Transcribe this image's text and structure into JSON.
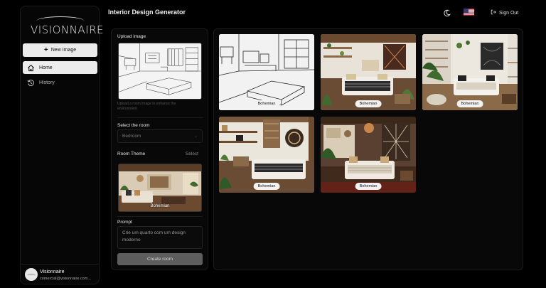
{
  "brand": {
    "logo_text": "VISIONNAIRE"
  },
  "sidebar": {
    "new_image_label": "New Image",
    "nav": [
      {
        "label": "Home",
        "icon": "home-icon",
        "active": true
      },
      {
        "label": "History",
        "icon": "history-icon",
        "active": false
      }
    ],
    "user": {
      "name": "Visionnaire",
      "email": "comercial@visionnaire.com..."
    }
  },
  "header": {
    "title": "Interior Design Generator",
    "language_flag": "us-flag-icon",
    "sign_out_label": "Sign Out"
  },
  "form": {
    "upload_label": "Upload image",
    "upload_hint": "Upload a room image to enhance the environment",
    "room_label": "Select the room",
    "room_value": "Bedroom",
    "theme_label": "Room Theme",
    "theme_select_label": "Select",
    "theme_selected": "Bohemian",
    "prompt_label": "Prompt",
    "prompt_value": "Crie um quarto com um design moderno",
    "create_label": "Create room"
  },
  "results": [
    {
      "label": "Bohemian",
      "style": "sketch"
    },
    {
      "label": "Bohemian",
      "style": "render"
    },
    {
      "label": "Bohemian",
      "style": "render"
    },
    {
      "label": "Bohemian",
      "style": "render"
    },
    {
      "label": "Bohemian",
      "style": "render"
    }
  ],
  "colors": {
    "background": "#000000",
    "panel": "#080808",
    "accent": "#ececec",
    "button_disabled": "#5d5d5d"
  }
}
